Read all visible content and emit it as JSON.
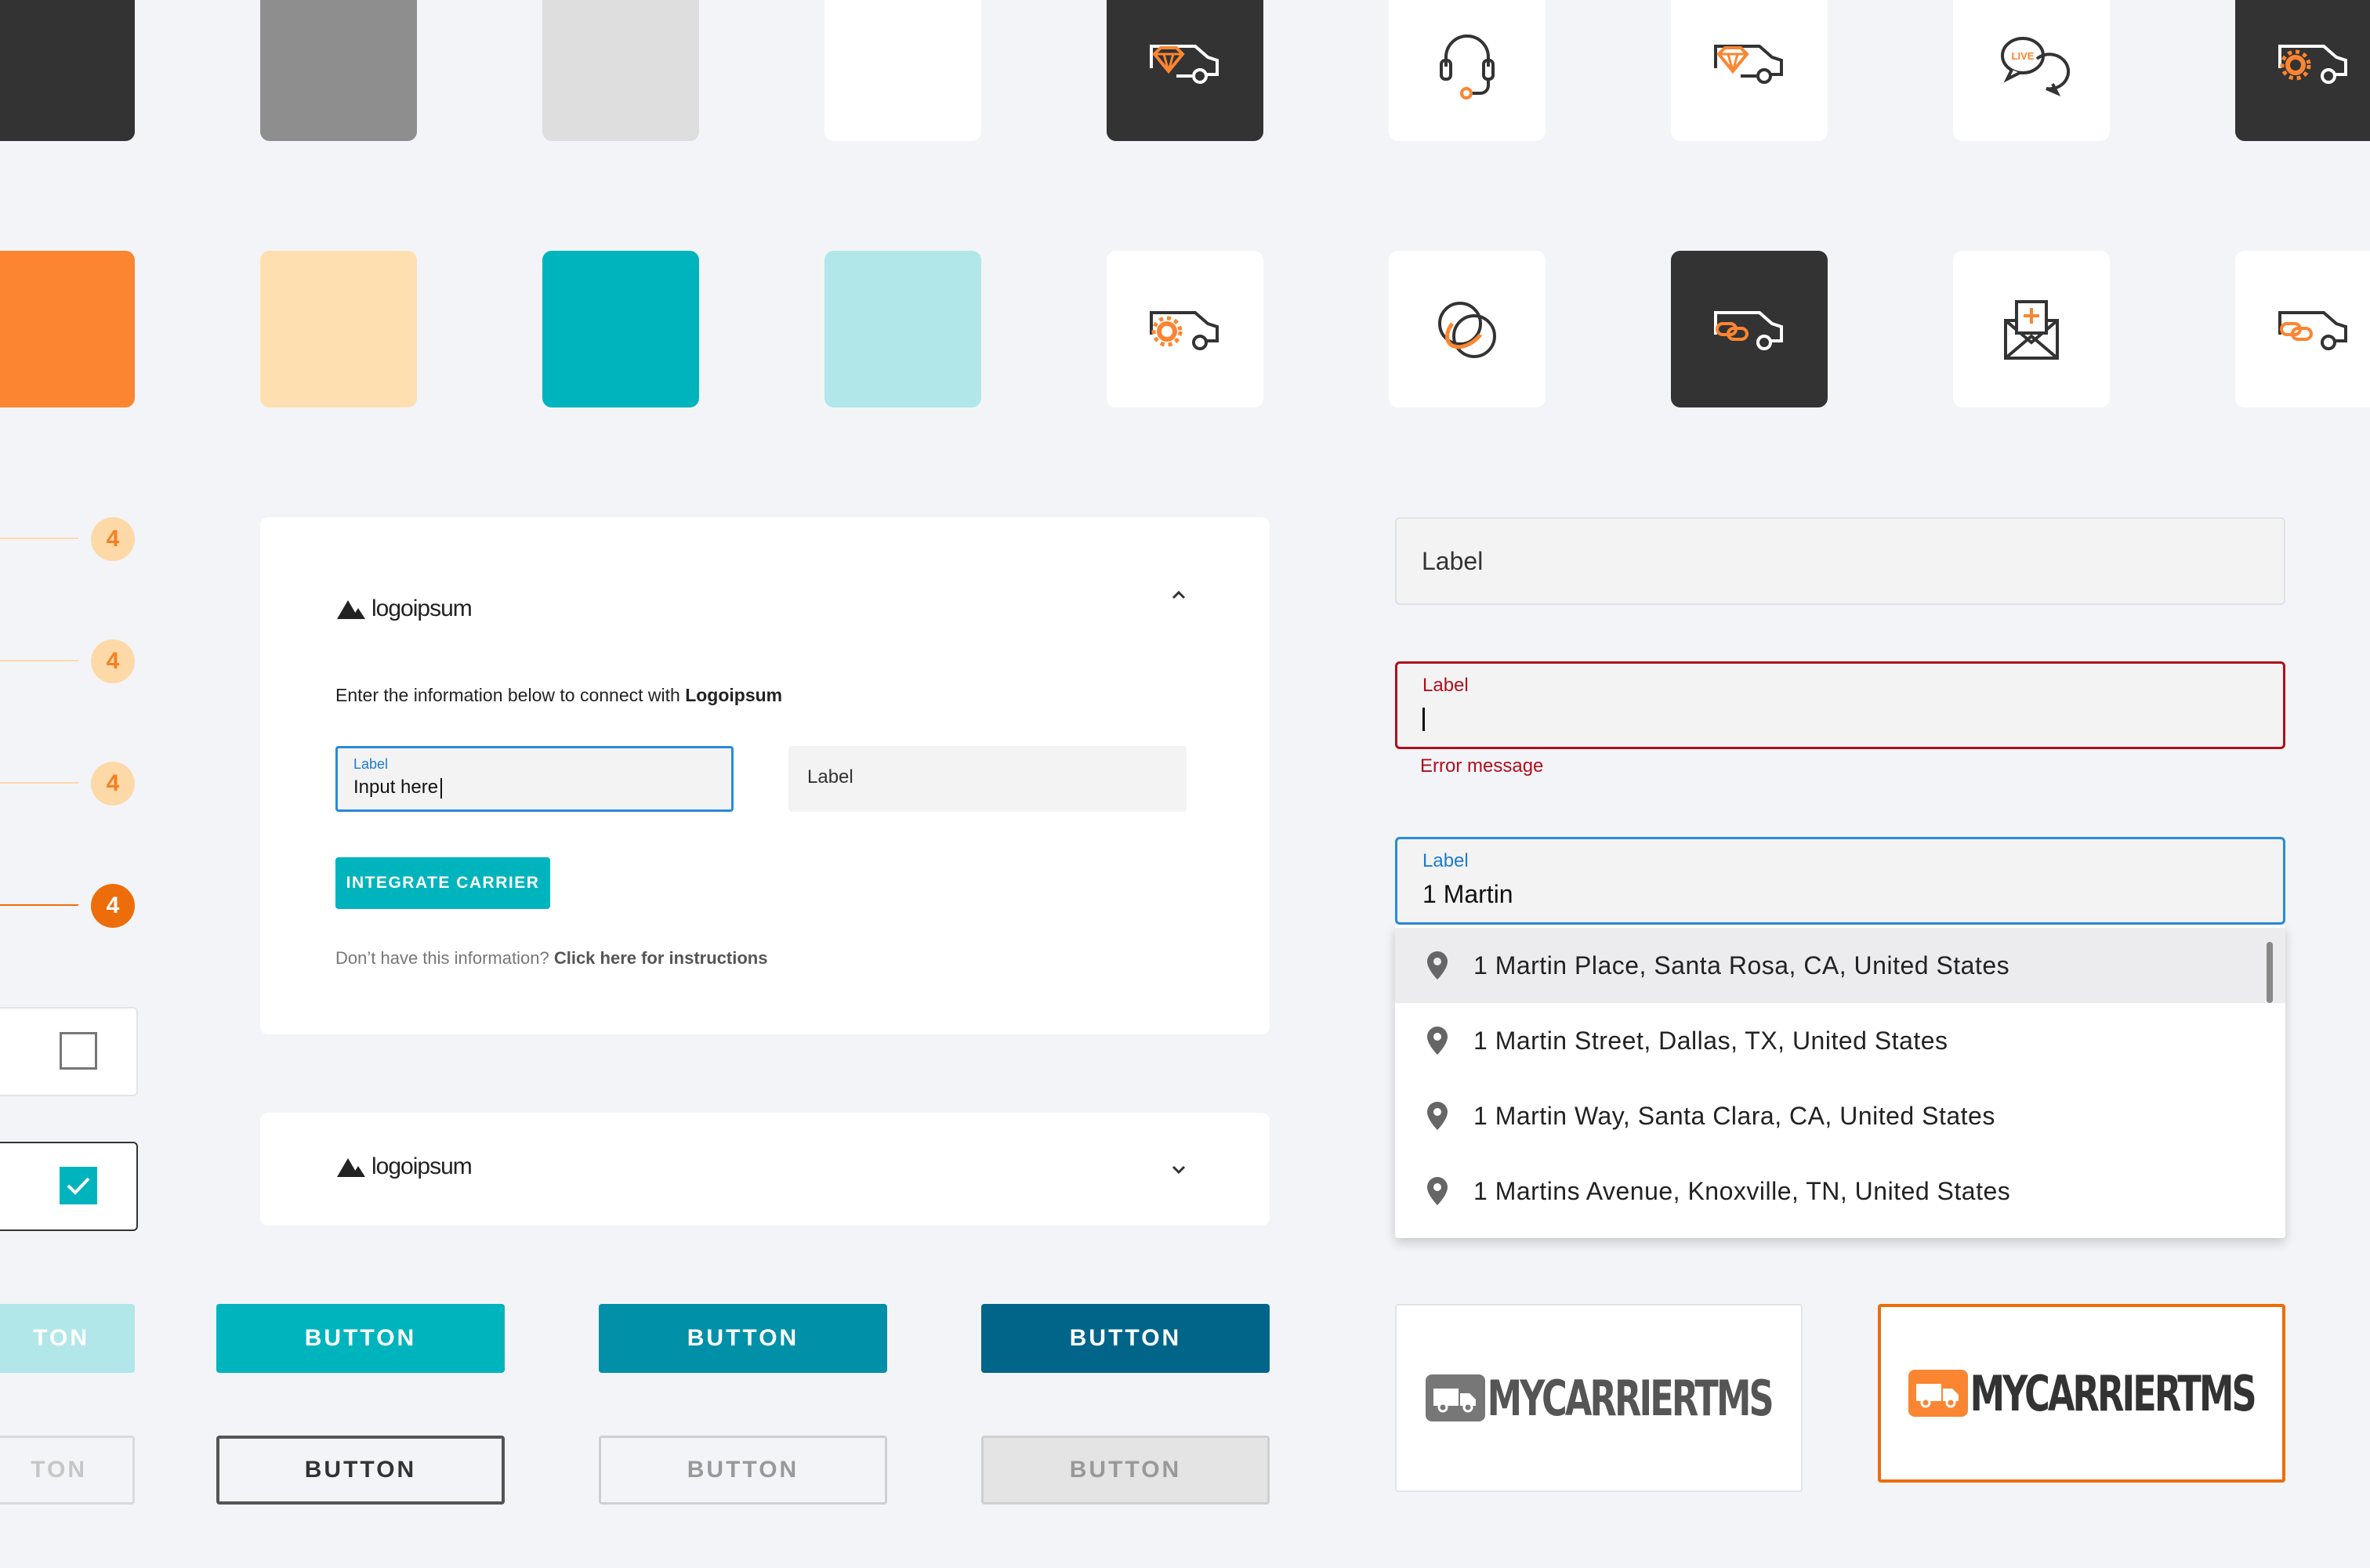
{
  "colors": {
    "background": "#f3f4f8",
    "dark": "#333333",
    "gray": "#8e8e8e",
    "light_gray": "#dedede",
    "white": "#ffffff",
    "orange": "#fb8531",
    "peach": "#fee0b0",
    "teal": "#00b4bd",
    "light_teal": "#b2e7e9",
    "teal_dark": "#0090a8",
    "navy_teal": "#006589",
    "error": "#b10e1c",
    "focus_blue": "#2a8ad9"
  },
  "icons_row1": [
    {
      "name": "truck-diamond-icon",
      "bg": "dark"
    },
    {
      "name": "headset-icon",
      "bg": "white"
    },
    {
      "name": "truck-diamond-icon",
      "bg": "white"
    },
    {
      "name": "live-chat-icon",
      "bg": "white",
      "text": "LIVE"
    },
    {
      "name": "truck-gear-icon",
      "bg": "dark"
    }
  ],
  "icons_row2": [
    {
      "name": "truck-gear-icon",
      "bg": "white"
    },
    {
      "name": "overlap-circles-icon",
      "bg": "white"
    },
    {
      "name": "truck-link-icon",
      "bg": "dark"
    },
    {
      "name": "mail-add-icon",
      "bg": "white"
    },
    {
      "name": "truck-link-icon",
      "bg": "white"
    }
  ],
  "steps": [
    "4",
    "4",
    "4",
    "4"
  ],
  "card": {
    "logo_text": "logoipsum",
    "intro_prefix": "Enter the information below to connect with ",
    "intro_bold": "Logoipsum",
    "input1_label": "Label",
    "input1_value": "Input here",
    "input2_label": "Label",
    "button": "INTEGRATE CARRIER",
    "help_prefix": "Don’t have this information? ",
    "help_link": "Click here for instructions"
  },
  "card_collapsed": {
    "logo_text": "logoipsum"
  },
  "right_fields": {
    "plain_label": "Label",
    "error_label": "Label",
    "error_message": "Error message",
    "address_label": "Label",
    "address_value": "1 Martin"
  },
  "address_suggestions": [
    "1 Martin Place, Santa Rosa, CA, United States",
    "1 Martin Street, Dallas, TX, United States",
    "1 Martin Way, Santa Clara, CA, United States",
    "1 Martins Avenue, Knoxville, TN, United States"
  ],
  "buttons": {
    "partial": "TON",
    "primary": "BUTTON",
    "hover": "BUTTON",
    "pressed": "BUTTON",
    "outline": "BUTTON",
    "outline_light": "BUTTON",
    "disabled": "BUTTON"
  },
  "brand": {
    "text": "MYCARRIERTMS"
  }
}
